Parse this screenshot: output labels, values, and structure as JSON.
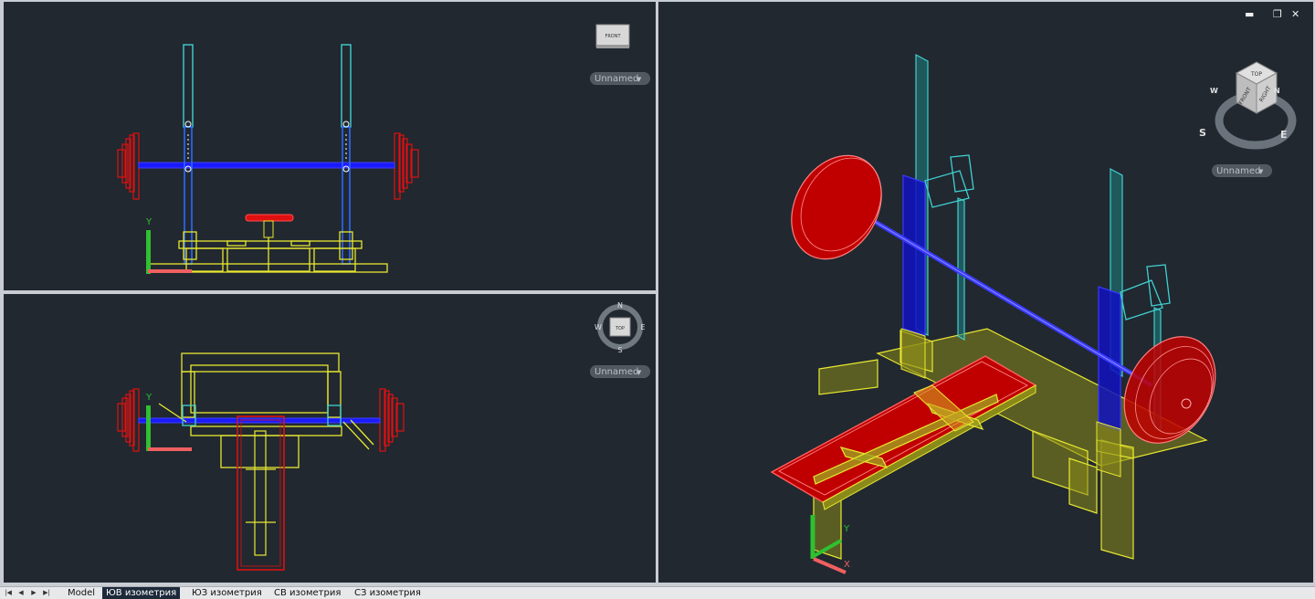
{
  "viewports": {
    "front": {
      "cube_label": "FRONT",
      "view_style": "Unnamed",
      "ucs_y": "Y"
    },
    "top": {
      "cube_label": "TOP",
      "compass": {
        "n": "N",
        "s": "S",
        "e": "E",
        "w": "W"
      },
      "view_style": "Unnamed",
      "ucs_y": "Y"
    },
    "iso": {
      "cube_top": "TOP",
      "cube_front": "FRONT",
      "cube_right": "RIGHT",
      "compass": {
        "s": "S",
        "e": "E",
        "w": "W",
        "n": "N"
      },
      "view_style": "Unnamed",
      "ucs_x": "X",
      "ucs_y": "Y"
    }
  },
  "window_controls": {
    "minimize": "▬",
    "restore": "❐",
    "close": "✕"
  },
  "nav": {
    "first": "|◀",
    "prev": "◀",
    "next": "▶",
    "last": "▶|"
  },
  "tabs": [
    "Model",
    "ЮВ изометрия",
    "ЮЗ изометрия",
    "СВ изометрия",
    "СЗ изометрия"
  ],
  "active_tab": 1,
  "colors": {
    "background": "#212830",
    "yellow": "#e8e830",
    "cyan": "#40d0d0",
    "blue": "#1a1aff",
    "red": "#e01010"
  }
}
